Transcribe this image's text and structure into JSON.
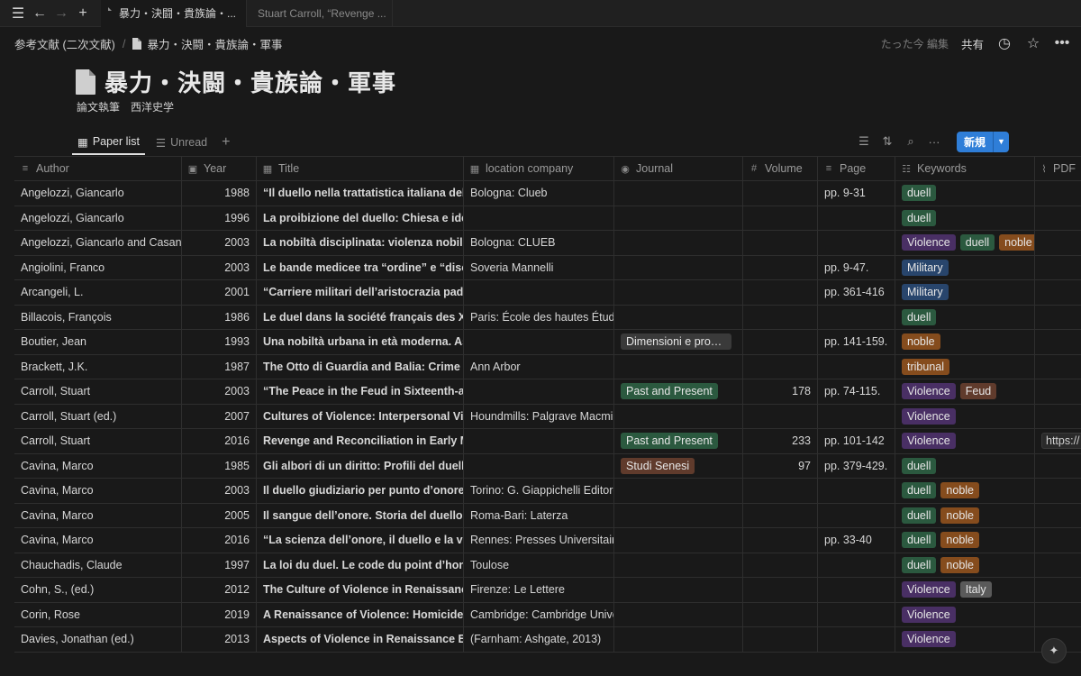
{
  "tabs": [
    {
      "label": "暴力・決闘・貴族論・...",
      "active": true
    },
    {
      "label": "Stuart Carroll, “Revenge ...",
      "active": false
    }
  ],
  "breadcrumb": {
    "parent": "参考文献 (二次文献)",
    "page": "暴力・決闘・貴族論・軍事"
  },
  "topbar": {
    "edited": "たった今 編集",
    "share": "共有"
  },
  "page": {
    "title": "暴力・決闘・貴族論・軍事",
    "description": "論文執筆　西洋史学"
  },
  "views": [
    {
      "label": "Paper list",
      "active": true
    },
    {
      "label": "Unread",
      "active": false
    }
  ],
  "toolbar": {
    "new_label": "新規"
  },
  "columns": {
    "author": "Author",
    "year": "Year",
    "title": "Title",
    "location": "location company",
    "journal": "Journal",
    "volume": "Volume",
    "page": "Page",
    "keywords": "Keywords",
    "pdf": "PDF"
  },
  "rows": [
    {
      "author": "Angelozzi, Giancarlo",
      "year": "1988",
      "title": "“Il duello nella trattatistica italiana della prima",
      "location": "Bologna: Clueb",
      "journal": "",
      "journal_color": "",
      "volume": "",
      "page": "pp. 9-31",
      "keywords": [
        {
          "label": "duell",
          "color": "green"
        }
      ],
      "pdf": ""
    },
    {
      "author": "Angelozzi, Giancarlo",
      "year": "1996",
      "title": "La proibizione del duello: Chiesa e ideologia",
      "location": "",
      "journal": "",
      "journal_color": "",
      "volume": "",
      "page": "",
      "keywords": [
        {
          "label": "duell",
          "color": "green"
        }
      ],
      "pdf": ""
    },
    {
      "author": "Angelozzi, Giancarlo and Casanova",
      "year": "2003",
      "title": "La nobiltà disciplinata: violenza nobiliare",
      "location": "Bologna: CLUEB",
      "journal": "",
      "journal_color": "",
      "volume": "",
      "page": "",
      "keywords": [
        {
          "label": "Violence",
          "color": "purple"
        },
        {
          "label": "duell",
          "color": "green"
        },
        {
          "label": "noble",
          "color": "orange"
        }
      ],
      "pdf": ""
    },
    {
      "author": "Angiolini, Franco",
      "year": "2003",
      "title": "Le bande medicee tra “ordine” e “disordine”",
      "location": "Soveria Mannelli",
      "journal": "",
      "journal_color": "",
      "volume": "",
      "page": "pp. 9-47.",
      "keywords": [
        {
          "label": "Military",
          "color": "blue"
        }
      ],
      "pdf": ""
    },
    {
      "author": "Arcangeli, L.",
      "year": "2001",
      "title": "“Carriere militari dell’aristocrazia padana",
      "location": "",
      "journal": "",
      "journal_color": "",
      "volume": "",
      "page": "pp. 361-416",
      "keywords": [
        {
          "label": "Military",
          "color": "blue"
        }
      ],
      "pdf": ""
    },
    {
      "author": "Billacois, François",
      "year": "1986",
      "title": "Le duel dans la société français des XVIe",
      "location": "Paris: École des hautes Études",
      "journal": "",
      "journal_color": "",
      "volume": "",
      "page": "",
      "keywords": [
        {
          "label": "duell",
          "color": "green"
        }
      ],
      "pdf": ""
    },
    {
      "author": "Boutier, Jean",
      "year": "1993",
      "title": "Una nobiltà urbana in età moderna. Aspetti",
      "location": "",
      "journal": "Dimensioni e problemi della ricerca",
      "journal_color": "journal-gray",
      "volume": "",
      "page": "pp. 141-159.",
      "keywords": [
        {
          "label": "noble",
          "color": "orange"
        }
      ],
      "pdf": ""
    },
    {
      "author": "Brackett, J.K.",
      "year": "1987",
      "title": "The Otto di Guardia and Balia: Crime and",
      "location": "Ann Arbor",
      "journal": "",
      "journal_color": "",
      "volume": "",
      "page": "",
      "keywords": [
        {
          "label": "tribunal",
          "color": "orange"
        }
      ],
      "pdf": ""
    },
    {
      "author": "Carroll, Stuart",
      "year": "2003",
      "title": "“The Peace in the Feud in Sixteenth-and",
      "location": "",
      "journal": "Past and Present",
      "journal_color": "green",
      "volume": "178",
      "page": "pp. 74-115.",
      "keywords": [
        {
          "label": "Violence",
          "color": "purple"
        },
        {
          "label": "Feud",
          "color": "brown"
        }
      ],
      "pdf": ""
    },
    {
      "author": "Carroll, Stuart (ed.)",
      "year": "2007",
      "title": "Cultures of Violence: Interpersonal Violence",
      "location": "Houndmills: Palgrave Macmillan",
      "journal": "",
      "journal_color": "",
      "volume": "",
      "page": "",
      "keywords": [
        {
          "label": "Violence",
          "color": "purple"
        }
      ],
      "pdf": ""
    },
    {
      "author": "Carroll, Stuart",
      "year": "2016",
      "title": "Revenge and Reconciliation in Early Modern",
      "location": "",
      "journal": "Past and Present",
      "journal_color": "green",
      "volume": "233",
      "page": "pp. 101-142",
      "keywords": [
        {
          "label": "Violence",
          "color": "purple"
        }
      ],
      "pdf": "https://"
    },
    {
      "author": "Cavina, Marco",
      "year": "1985",
      "title": "Gli albori di un diritto: Profili del duello cavalleresco",
      "location": "",
      "journal": "Studi Senesi",
      "journal_color": "brown",
      "volume": "97",
      "page": "pp. 379-429.",
      "keywords": [
        {
          "label": "duell",
          "color": "green"
        }
      ],
      "pdf": ""
    },
    {
      "author": "Cavina, Marco",
      "year": "2003",
      "title": "Il duello giudiziario per punto d’onore: Genesi",
      "location": "Torino: G. Giappichelli Editore",
      "journal": "",
      "journal_color": "",
      "volume": "",
      "page": "",
      "keywords": [
        {
          "label": "duell",
          "color": "green"
        },
        {
          "label": "noble",
          "color": "orange"
        }
      ],
      "pdf": ""
    },
    {
      "author": "Cavina, Marco",
      "year": "2005",
      "title": "Il sangue dell’onore. Storia del duello",
      "location": "Roma-Bari: Laterza",
      "journal": "",
      "journal_color": "",
      "volume": "",
      "page": "",
      "keywords": [
        {
          "label": "duell",
          "color": "green"
        },
        {
          "label": "noble",
          "color": "orange"
        }
      ],
      "pdf": ""
    },
    {
      "author": "Cavina, Marco",
      "year": "2016",
      "title": "“La scienza dell’onore, il duello e la vendetta",
      "location": "Rennes: Presses Universitaires",
      "journal": "",
      "journal_color": "",
      "volume": "",
      "page": "pp. 33-40",
      "keywords": [
        {
          "label": "duell",
          "color": "green"
        },
        {
          "label": "noble",
          "color": "orange"
        }
      ],
      "pdf": ""
    },
    {
      "author": "Chauchadis, Claude",
      "year": "1997",
      "title": "La loi du duel. Le code du point d’honneur",
      "location": "Toulose",
      "journal": "",
      "journal_color": "",
      "volume": "",
      "page": "",
      "keywords": [
        {
          "label": "duell",
          "color": "green"
        },
        {
          "label": "noble",
          "color": "orange"
        }
      ],
      "pdf": ""
    },
    {
      "author": "Cohn, S., (ed.)",
      "year": "2012",
      "title": "The Culture of Violence in Renaissance Italy",
      "location": "Firenze: Le Lettere",
      "journal": "",
      "journal_color": "",
      "volume": "",
      "page": "",
      "keywords": [
        {
          "label": "Violence",
          "color": "purple"
        },
        {
          "label": "Italy",
          "color": "gray"
        }
      ],
      "pdf": ""
    },
    {
      "author": "Corin, Rose",
      "year": "2019",
      "title": "A Renaissance of Violence: Homicide in Early",
      "location": "Cambridge: Cambridge University",
      "journal": "",
      "journal_color": "",
      "volume": "",
      "page": "",
      "keywords": [
        {
          "label": "Violence",
          "color": "purple"
        }
      ],
      "pdf": ""
    },
    {
      "author": "Davies, Jonathan (ed.)",
      "year": "2013",
      "title": "Aspects of Violence in Renaissance Europe",
      "location": "(Farnham: Ashgate, 2013)",
      "journal": "",
      "journal_color": "",
      "volume": "",
      "page": "",
      "keywords": [
        {
          "label": "Violence",
          "color": "purple"
        }
      ],
      "pdf": ""
    }
  ]
}
